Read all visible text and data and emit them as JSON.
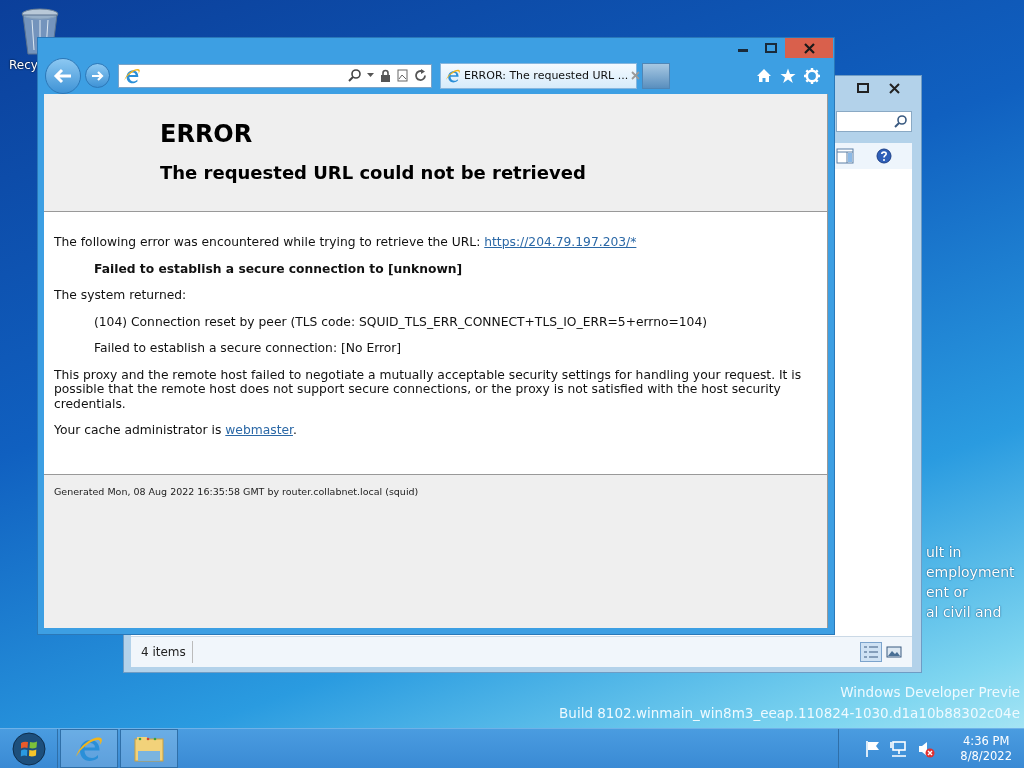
{
  "desktop": {
    "icons": [
      {
        "label": "Recy"
      }
    ],
    "background_text": [
      "ult in",
      "employment",
      "ent or",
      "al civil and"
    ],
    "os_build_text": [
      "Windows Developer Previe",
      "Build 8102.winmain_win8m3_eeap.110824-1030.d1a10b88302c04e"
    ]
  },
  "explorer_window": {
    "status_bar": "4 items"
  },
  "browser": {
    "tab": {
      "title": "ERROR: The requested URL ...",
      "selected": true
    },
    "page": {
      "heading": "ERROR",
      "subheading": "The requested URL could not be retrieved",
      "paragraphs": [
        {
          "kind": "plain",
          "text": "The following error was encountered while trying to retrieve the URL: ",
          "link": "https://204.79.197.203/*"
        },
        {
          "kind": "indent-bold",
          "text": "Failed to establish a secure connection to [unknown]"
        },
        {
          "kind": "plain",
          "text": "The system returned:"
        },
        {
          "kind": "indent",
          "text": "(104) Connection reset by peer (TLS code: SQUID_TLS_ERR_CONNECT+TLS_IO_ERR=5+errno=104)"
        },
        {
          "kind": "indent",
          "text": "Failed to establish a secure connection: [No Error]"
        },
        {
          "kind": "plain",
          "text": "This proxy and the remote host failed to negotiate a mutually acceptable security settings for handling your request. It is possible that the remote host does not support secure connections, or the proxy is not satisfied with the host security credentials."
        },
        {
          "kind": "plain",
          "text": "Your cache administrator is ",
          "link": "webmaster",
          "after": "."
        }
      ],
      "footer": "Generated Mon, 08 Aug 2022 16:35:58 GMT by router.collabnet.local (squid)"
    }
  },
  "taskbar": {
    "clock": {
      "time": "4:36 PM",
      "date": "8/8/2022"
    }
  }
}
